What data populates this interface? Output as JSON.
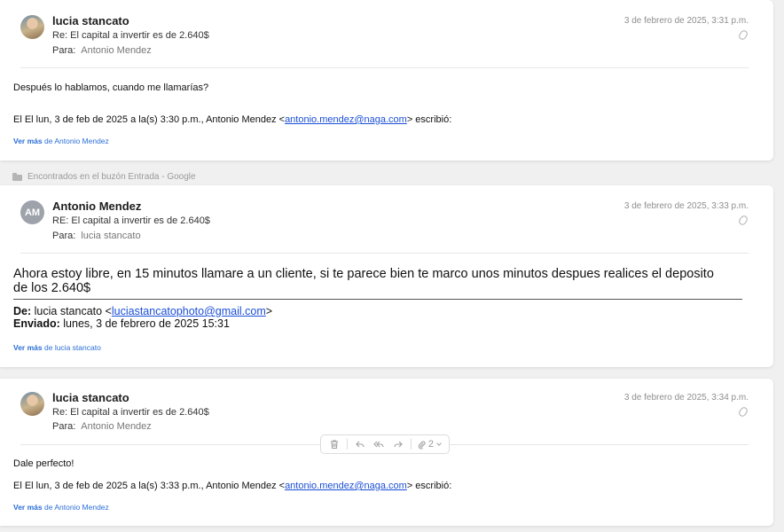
{
  "messages": [
    {
      "sender": "lucia stancato",
      "subject": "Re: El capital a invertir es de 2.640$",
      "to_label": "Para:",
      "to": "Antonio Mendez",
      "date": "3 de febrero de 2025, 3:31 p.m.",
      "body": "Después lo hablamos, cuando me llamarías?",
      "quote_prefix": "El El lun, 3 de feb de 2025 a la(s) 3:30 p.m., Antonio Mendez <",
      "quote_email": "antonio.mendez@naga.com",
      "quote_suffix": "> escribió:",
      "see_more": "Ver más",
      "see_more_from": "de Antonio Mendez"
    },
    {
      "sender": "Antonio Mendez",
      "initials": "AM",
      "subject": "RE: El capital a invertir es de 2.640$",
      "to_label": "Para:",
      "to": "lucia stancato",
      "date": "3 de febrero de 2025, 3:33 p.m.",
      "body": "Ahora estoy libre, en 15 minutos llamare a un cliente, si te parece bien te marco unos minutos despues realices el deposito de los 2.640$",
      "from_label": "De:",
      "from_name": "lucia stancato <",
      "from_email": "luciastancatophoto@gmail.com",
      "from_suffix": ">",
      "sent_label": "Enviado:",
      "sent_value": "lunes, 3 de febrero de 2025 15:31",
      "see_more": "Ver más",
      "see_more_from": "de lucia stancato"
    },
    {
      "sender": "lucia stancato",
      "subject": "Re: El capital a invertir es de 2.640$",
      "to_label": "Para:",
      "to": "Antonio Mendez",
      "date": "3 de febrero de 2025, 3:34 p.m.",
      "body": "Dale perfecto!",
      "quote_prefix": "El El lun, 3 de feb de 2025 a la(s) 3:33 p.m., Antonio Mendez <",
      "quote_email": "antonio.mendez@naga.com",
      "quote_suffix": "> escribió:",
      "see_more": "Ver más",
      "see_more_from": "de Antonio Mendez"
    }
  ],
  "folder_note": "Encontrados en el buzón Entrada - Google",
  "toolbar": {
    "attachment_count": "2",
    "icons": [
      "trash-icon",
      "reply-icon",
      "reply-all-icon",
      "forward-icon",
      "paperclip-icon",
      "chevron-down-icon"
    ]
  },
  "colors": {
    "link": "#1a4fd6",
    "see_more": "#2b6fd6",
    "date": "#8e8e8e",
    "background": "#f0f0f0"
  }
}
